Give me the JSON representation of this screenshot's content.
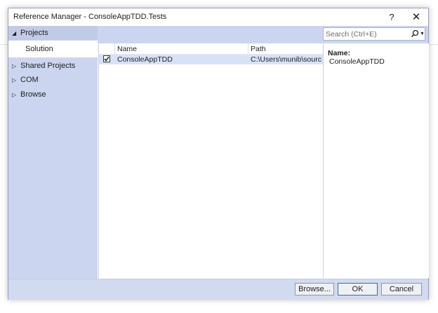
{
  "window": {
    "title": "Reference Manager - ConsoleAppTDD.Tests",
    "help_glyph": "?",
    "close_glyph": "✕"
  },
  "nav": {
    "items": [
      {
        "label": "Projects",
        "expanded": true
      },
      {
        "label": "Solution",
        "selected": true
      },
      {
        "label": "Shared Projects",
        "expanded": false
      },
      {
        "label": "COM",
        "expanded": false
      },
      {
        "label": "Browse",
        "expanded": false
      }
    ]
  },
  "search": {
    "placeholder": "Search (Ctrl+E)"
  },
  "grid": {
    "columns": [
      "Name",
      "Path"
    ],
    "rows": [
      {
        "checked": true,
        "name": "ConsoleAppTDD",
        "path": "C:\\Users\\munib\\sourc..."
      }
    ]
  },
  "details": {
    "label": "Name:",
    "value": "ConsoleAppTDD"
  },
  "buttons": {
    "browse": "Browse...",
    "ok": "OK",
    "cancel": "Cancel"
  },
  "colors": {
    "nav_bg": "#ccd5f0",
    "selected_row": "#d7e2f7",
    "footer_bg": "#d2daf0"
  }
}
